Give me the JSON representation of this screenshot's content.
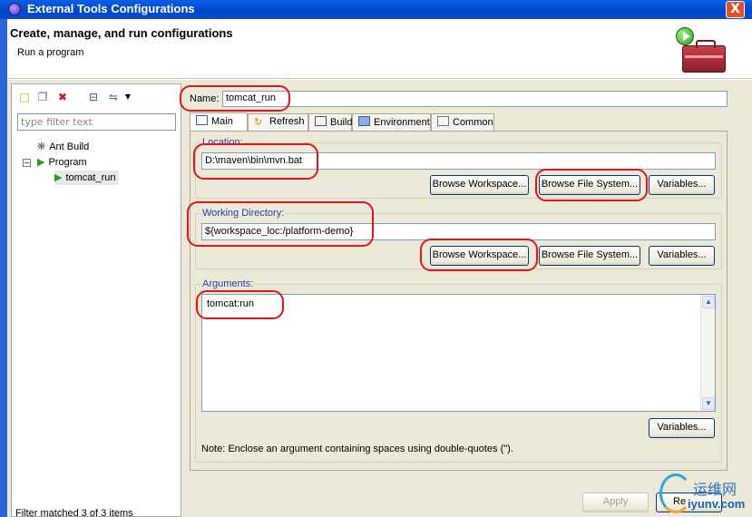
{
  "window": {
    "title": "External Tools Configurations",
    "close_glyph": "X"
  },
  "header": {
    "title": "Create, manage, and run configurations",
    "subtitle": "Run a program"
  },
  "left_pane": {
    "filter_placeholder": "type filter text",
    "tree": [
      {
        "label": "Ant Build",
        "icon": "ant-icon"
      },
      {
        "label": "Program",
        "icon": "program-icon",
        "expanded": true
      },
      {
        "label": "tomcat_run",
        "icon": "program-config-icon",
        "selected": true
      }
    ],
    "status": "Filter matched 3 of 3 items"
  },
  "config": {
    "name_label": "Name:",
    "name_value": "tomcat_run",
    "tabs": [
      {
        "label": "Main",
        "icon": "main-tab-icon"
      },
      {
        "label": "Refresh",
        "icon": "refresh-icon"
      },
      {
        "label": "Build",
        "icon": "build-icon"
      },
      {
        "label": "Environment",
        "icon": "environment-icon"
      },
      {
        "label": "Common",
        "icon": "common-icon"
      }
    ],
    "location": {
      "label": "Location:",
      "value": "D:\\maven\\bin\\mvn.bat",
      "browse_workspace": "Browse Workspace...",
      "browse_fs": "Browse File System...",
      "variables": "Variables..."
    },
    "working_dir": {
      "label": "Working Directory:",
      "value": "${workspace_loc:/platform-demo}",
      "browse_workspace": "Browse Workspace...",
      "browse_fs": "Browse File System...",
      "variables": "Variables..."
    },
    "arguments": {
      "label": "Arguments:",
      "value": "tomcat:run",
      "variables": "Variables...",
      "note": "Note: Enclose an argument containing spaces using double-quotes (\")."
    }
  },
  "footer": {
    "apply_label": "Apply",
    "revert_label": "Re"
  },
  "watermark": {
    "cn_text": "运维网",
    "url": "iyunv.com"
  },
  "colors": {
    "annotation": "#e5141c",
    "group_label": "#1f3fa8",
    "titlebar": "#0147c8"
  }
}
